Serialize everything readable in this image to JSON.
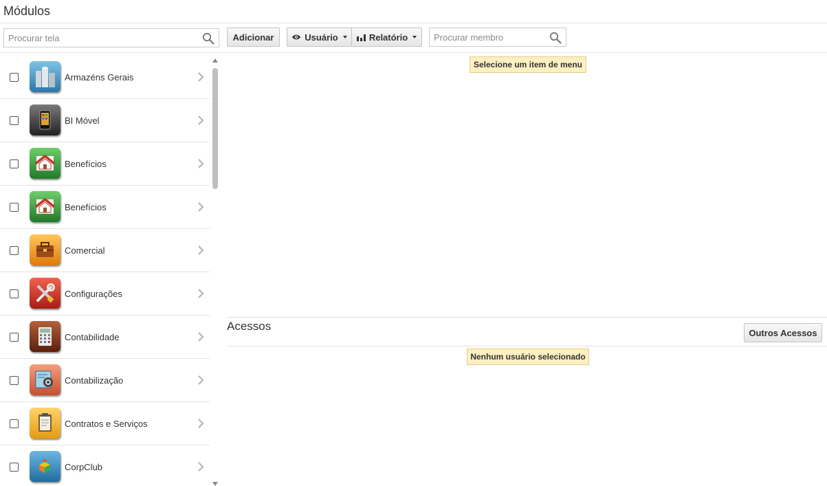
{
  "page": {
    "title": "Módulos"
  },
  "toolbar": {
    "screen_search_placeholder": "Procurar tela",
    "add_label": "Adicionar",
    "user_label": "Usuário",
    "report_label": "Relatório",
    "member_search_placeholder": "Procurar membro"
  },
  "modules": [
    {
      "label": "Armazéns Gerais",
      "icon": "warehouse-icon"
    },
    {
      "label": "BI Móvel",
      "icon": "mobile-phone-icon"
    },
    {
      "label": "Benefícios",
      "icon": "house-icon"
    },
    {
      "label": "Benefícios",
      "icon": "house-icon"
    },
    {
      "label": "Comercial",
      "icon": "briefcase-icon"
    },
    {
      "label": "Configurações",
      "icon": "tools-icon"
    },
    {
      "label": "Contabilidade",
      "icon": "calculator-icon"
    },
    {
      "label": "Contabilização",
      "icon": "gear-document-icon"
    },
    {
      "label": "Contratos e Serviços",
      "icon": "clipboard-icon"
    },
    {
      "label": "CorpClub",
      "icon": "boxes-icon"
    }
  ],
  "menu_panel": {
    "notice": "Selecione um item de menu"
  },
  "access": {
    "title": "Acessos",
    "other_access_label": "Outros Acessos",
    "notice": "Nenhum usuário selecionado"
  },
  "colors": {
    "notice_bg": "#fcefc2",
    "notice_border": "#e4cf84",
    "tile_blue": "#3f8fbf",
    "tile_dark": "#3a3a3a",
    "tile_green": "#3aa33f",
    "tile_orange": "#f29b1d",
    "tile_red": "#d8332a",
    "tile_brown": "#8b3a1c",
    "tile_salmon": "#e7795b",
    "tile_yellow": "#f3b834"
  }
}
